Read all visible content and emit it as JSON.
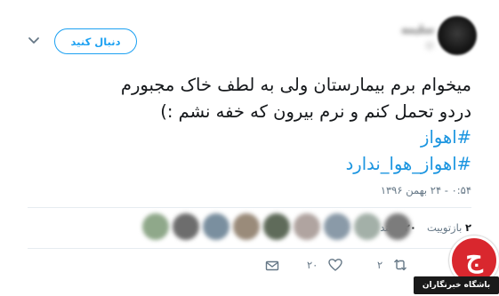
{
  "header": {
    "follow_label": "دنبال کنید",
    "account_name": "سلیمه",
    "account_handle": "@"
  },
  "tweet": {
    "lines": [
      "میخوام برم بیمارستان ولی به لطف خاک مجبورم",
      "دردو تحمل کنم و نرم بیرون که خفه نشم :)"
    ],
    "hashtags": [
      "#اهواز",
      "#اهواز_هوا_ندارد"
    ],
    "timestamp": "۰:۵۴ - ۲۴ بهمن ۱۳۹۶"
  },
  "stats": {
    "retweets_count": "۲",
    "retweets_label": "بازتوییت",
    "likes_count": "۲۰",
    "likes_label": "پسند"
  },
  "actions": {
    "retweet_count": "۲",
    "like_count": "۲۰"
  },
  "likers": {
    "colors": [
      "#8fa88a",
      "#6d6d6d",
      "#7a8f9f",
      "#9a8b7a",
      "#5f6b5a",
      "#b0a4a0",
      "#8a9aa8",
      "#a3b0a8",
      "#7c7c7c"
    ]
  },
  "watermark": {
    "label": "باشگاه خبرنگاران",
    "glyph": "ج",
    "color": "#d9272e"
  },
  "colors": {
    "accent": "#1da1f2",
    "hashtag": "#1b95e0",
    "secondary": "#657786"
  }
}
